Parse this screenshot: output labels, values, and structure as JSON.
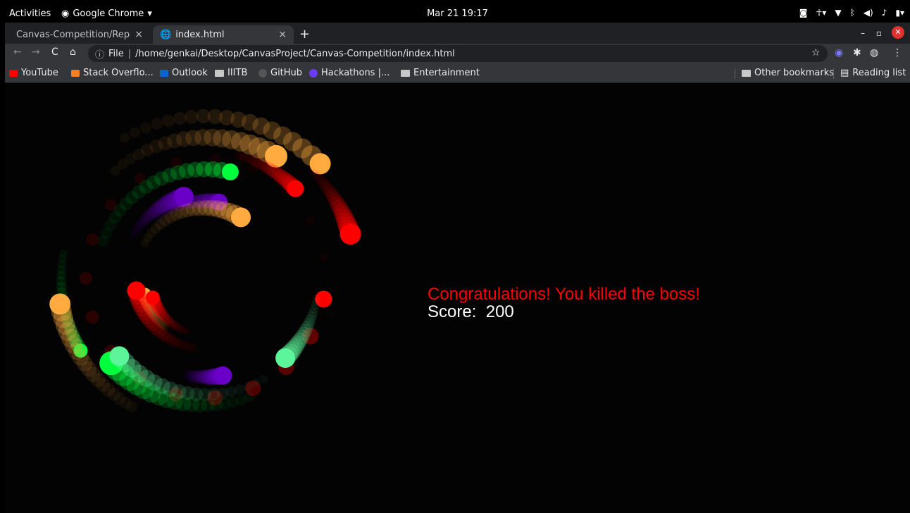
{
  "topbar": {
    "activities": "Activities",
    "app_name": "Google Chrome",
    "clock": "Mar 21  19:17"
  },
  "tabs": [
    {
      "title": "Canvas-Competition/Repo",
      "close": "×"
    },
    {
      "title": "index.html",
      "close": "×"
    }
  ],
  "new_tab": "+",
  "toolbar": {
    "back": "←",
    "forward": "→",
    "reload": "C",
    "home": "⌂",
    "security_label": "File",
    "url": "/home/genkai/Desktop/CanvasProject/Canvas-Competition/index.html"
  },
  "bookmarks": [
    {
      "label": "YouTube",
      "color": "#ff0000"
    },
    {
      "label": "Stack Overflo...",
      "color": "#f48024"
    },
    {
      "label": "Outlook",
      "color": "#0a64d6"
    },
    {
      "label": "IIITB",
      "color": "folder"
    },
    {
      "label": "GitHub",
      "color": "#555555"
    },
    {
      "label": "Hackathons |...",
      "color": "#6a3cf6"
    },
    {
      "label": "Entertainment",
      "color": "folder"
    }
  ],
  "bookmarks_right": {
    "other": "Other bookmarks",
    "reading": "Reading list"
  },
  "game": {
    "message": "Congratulations! You killed the boss!",
    "score_label": "Score:",
    "score_value": "200",
    "colors": {
      "green": "#00ff3c",
      "purple": "#6a00c8",
      "orange": "#ffab40",
      "red": "#ff0000",
      "mint": "#5df59a"
    }
  }
}
